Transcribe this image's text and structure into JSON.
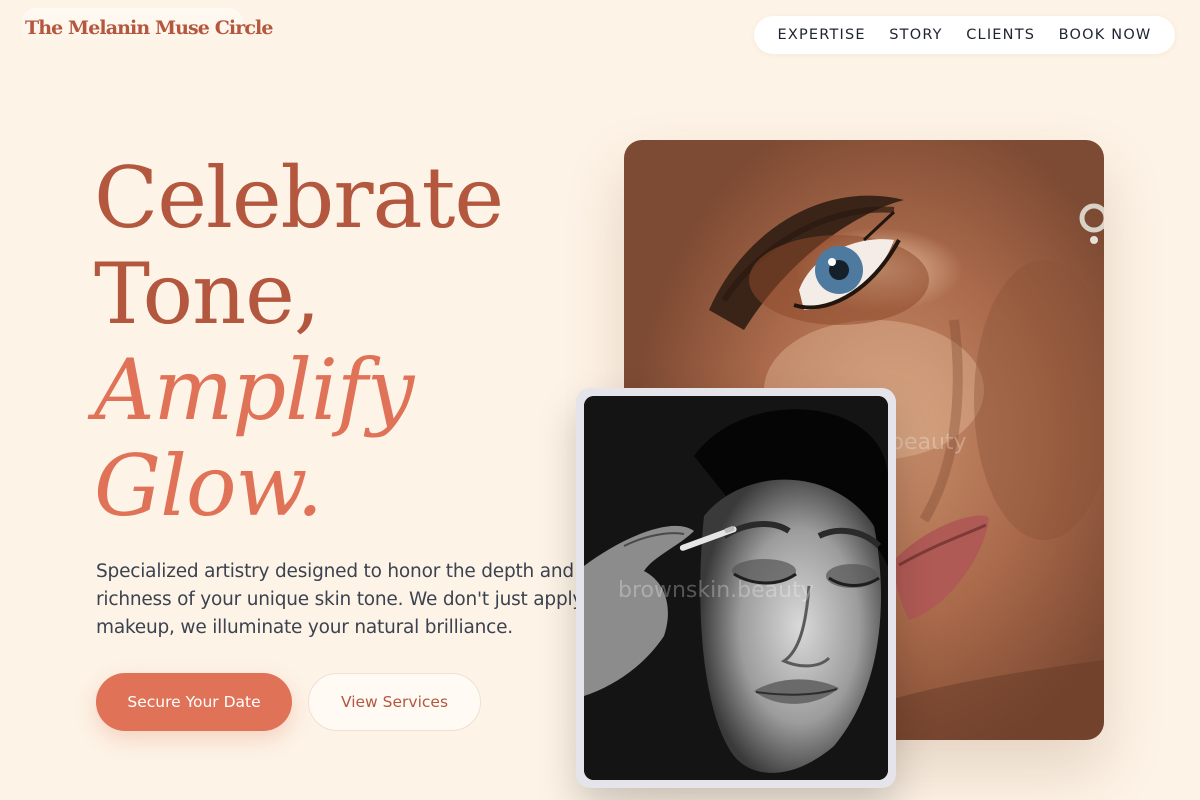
{
  "brand": {
    "name": "The Melanin Muse Circle"
  },
  "nav": {
    "items": [
      "EXPERTISE",
      "STORY",
      "CLIENTS",
      "BOOK NOW"
    ]
  },
  "hero": {
    "headline": {
      "line1": "Celebrate",
      "line2": "Tone,",
      "line3": "Amplify",
      "line4": "Glow."
    },
    "description": "Specialized artistry designed to honor the depth and richness of your unique skin tone. We don't just apply makeup, we illuminate your natural brilliance.",
    "primary_cta": "Secure Your Date",
    "secondary_cta": "View Services"
  },
  "photos": {
    "main_watermark": "beauty",
    "inset_watermark": "brownskin.beauty"
  },
  "colors": {
    "background": "#fdf3e6",
    "brand_terracotta": "#b4573f",
    "accent_coral": "#e07257",
    "body_text": "#3b4250",
    "nav_text": "#1f2430"
  }
}
